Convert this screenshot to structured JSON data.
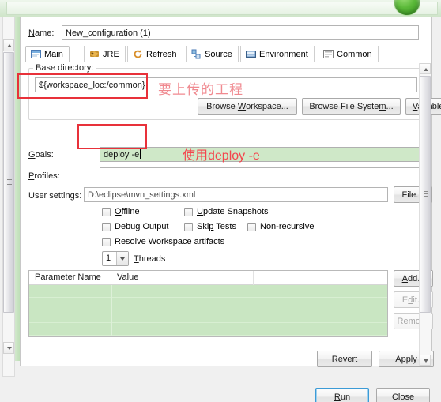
{
  "window": {
    "title_strip_color": "#cfe5c9",
    "orb_icon": "green-circle-button"
  },
  "dialog": {
    "name_label": "Name:",
    "name_value": "New_configuration (1)",
    "tabs": [
      {
        "label": "Main",
        "icon": "main-tab-icon",
        "active": true
      },
      {
        "label": "JRE",
        "icon": "jre-tab-icon",
        "active": false
      },
      {
        "label": "Refresh",
        "icon": "refresh-tab-icon",
        "active": false
      },
      {
        "label": "Source",
        "icon": "source-tab-icon",
        "active": false
      },
      {
        "label": "Environment",
        "icon": "environment-tab-icon",
        "active": false
      },
      {
        "label": "Common",
        "icon": "common-tab-icon",
        "active": false
      }
    ],
    "base_directory": {
      "group_title": "Base directory:",
      "value": "${workspace_loc:/common}",
      "buttons": [
        {
          "label": "Browse Workspace...",
          "name": "browse-workspace-button"
        },
        {
          "label": "Browse File System...",
          "name": "browse-file-system-button"
        },
        {
          "label": "Variables...",
          "name": "variables-button"
        }
      ]
    },
    "goals": {
      "label": "Goals:",
      "value": "deploy -e",
      "field_bg": "#cfe8c8"
    },
    "profiles": {
      "label": "Profiles:",
      "value": ""
    },
    "user_settings": {
      "label": "User settings:",
      "value": "D:\\eclipse\\mvn_settings.xml",
      "button_label": "File..."
    },
    "checkboxes": [
      {
        "label": "Offline",
        "checked": false,
        "name": "offline-checkbox"
      },
      {
        "label": "Update Snapshots",
        "checked": false,
        "name": "update-snapshots-checkbox"
      },
      {
        "label": "Debug Output",
        "checked": false,
        "name": "debug-output-checkbox"
      },
      {
        "label": "Skip Tests",
        "checked": false,
        "name": "skip-tests-checkbox"
      },
      {
        "label": "Non-recursive",
        "checked": false,
        "name": "non-recursive-checkbox"
      },
      {
        "label": "Resolve Workspace artifacts",
        "checked": false,
        "name": "resolve-workspace-artifacts-checkbox"
      }
    ],
    "threads": {
      "value": "1",
      "label": "Threads"
    },
    "parameters_table": {
      "columns": [
        "Parameter Name",
        "Value",
        ""
      ],
      "rows": [],
      "empty_row_count": 4,
      "row_bg": "#c9e6c2",
      "buttons": [
        {
          "label": "Add...",
          "enabled": true,
          "name": "add-parameter-button"
        },
        {
          "label": "Edit...",
          "enabled": false,
          "name": "edit-parameter-button"
        },
        {
          "label": "Remove",
          "enabled": false,
          "name": "remove-parameter-button"
        }
      ]
    },
    "revert_label": "Revert",
    "apply_label": "Apply",
    "run_label": "Run",
    "close_label": "Close"
  },
  "annotations": [
    {
      "text": "要上传的工程",
      "color": "#f08a90",
      "style": "pink"
    },
    {
      "text": "使用deploy -e",
      "color": "#f4454d",
      "style": "red"
    }
  ],
  "annotation_boxes": {
    "border_color": "#e8313a",
    "base_directory_box": "highlight-base-directory",
    "goals_box": "highlight-goals"
  }
}
